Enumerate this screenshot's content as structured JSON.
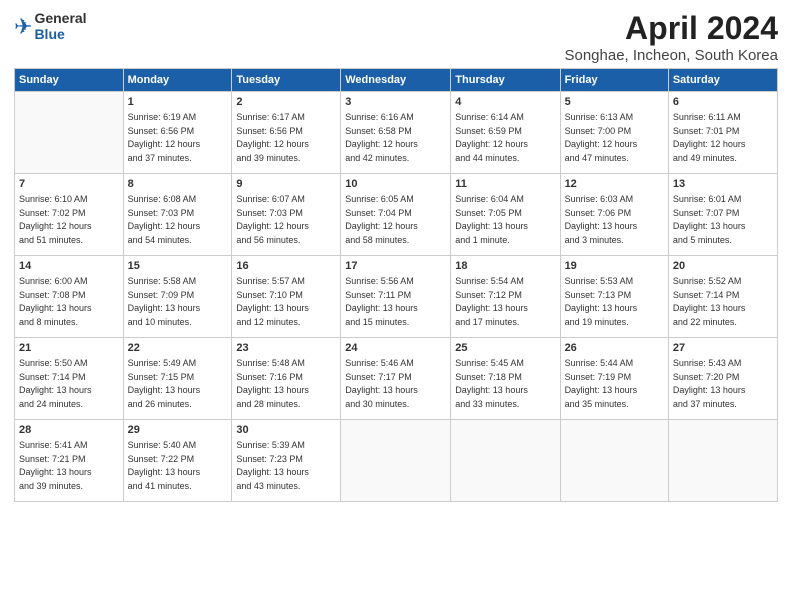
{
  "logo": {
    "general": "General",
    "blue": "Blue"
  },
  "title": "April 2024",
  "subtitle": "Songhae, Incheon, South Korea",
  "days_header": [
    "Sunday",
    "Monday",
    "Tuesday",
    "Wednesday",
    "Thursday",
    "Friday",
    "Saturday"
  ],
  "weeks": [
    [
      {
        "day": "",
        "info": ""
      },
      {
        "day": "1",
        "info": "Sunrise: 6:19 AM\nSunset: 6:56 PM\nDaylight: 12 hours\nand 37 minutes."
      },
      {
        "day": "2",
        "info": "Sunrise: 6:17 AM\nSunset: 6:56 PM\nDaylight: 12 hours\nand 39 minutes."
      },
      {
        "day": "3",
        "info": "Sunrise: 6:16 AM\nSunset: 6:58 PM\nDaylight: 12 hours\nand 42 minutes."
      },
      {
        "day": "4",
        "info": "Sunrise: 6:14 AM\nSunset: 6:59 PM\nDaylight: 12 hours\nand 44 minutes."
      },
      {
        "day": "5",
        "info": "Sunrise: 6:13 AM\nSunset: 7:00 PM\nDaylight: 12 hours\nand 47 minutes."
      },
      {
        "day": "6",
        "info": "Sunrise: 6:11 AM\nSunset: 7:01 PM\nDaylight: 12 hours\nand 49 minutes."
      }
    ],
    [
      {
        "day": "7",
        "info": "Sunrise: 6:10 AM\nSunset: 7:02 PM\nDaylight: 12 hours\nand 51 minutes."
      },
      {
        "day": "8",
        "info": "Sunrise: 6:08 AM\nSunset: 7:03 PM\nDaylight: 12 hours\nand 54 minutes."
      },
      {
        "day": "9",
        "info": "Sunrise: 6:07 AM\nSunset: 7:03 PM\nDaylight: 12 hours\nand 56 minutes."
      },
      {
        "day": "10",
        "info": "Sunrise: 6:05 AM\nSunset: 7:04 PM\nDaylight: 12 hours\nand 58 minutes."
      },
      {
        "day": "11",
        "info": "Sunrise: 6:04 AM\nSunset: 7:05 PM\nDaylight: 13 hours\nand 1 minute."
      },
      {
        "day": "12",
        "info": "Sunrise: 6:03 AM\nSunset: 7:06 PM\nDaylight: 13 hours\nand 3 minutes."
      },
      {
        "day": "13",
        "info": "Sunrise: 6:01 AM\nSunset: 7:07 PM\nDaylight: 13 hours\nand 5 minutes."
      }
    ],
    [
      {
        "day": "14",
        "info": "Sunrise: 6:00 AM\nSunset: 7:08 PM\nDaylight: 13 hours\nand 8 minutes."
      },
      {
        "day": "15",
        "info": "Sunrise: 5:58 AM\nSunset: 7:09 PM\nDaylight: 13 hours\nand 10 minutes."
      },
      {
        "day": "16",
        "info": "Sunrise: 5:57 AM\nSunset: 7:10 PM\nDaylight: 13 hours\nand 12 minutes."
      },
      {
        "day": "17",
        "info": "Sunrise: 5:56 AM\nSunset: 7:11 PM\nDaylight: 13 hours\nand 15 minutes."
      },
      {
        "day": "18",
        "info": "Sunrise: 5:54 AM\nSunset: 7:12 PM\nDaylight: 13 hours\nand 17 minutes."
      },
      {
        "day": "19",
        "info": "Sunrise: 5:53 AM\nSunset: 7:13 PM\nDaylight: 13 hours\nand 19 minutes."
      },
      {
        "day": "20",
        "info": "Sunrise: 5:52 AM\nSunset: 7:14 PM\nDaylight: 13 hours\nand 22 minutes."
      }
    ],
    [
      {
        "day": "21",
        "info": "Sunrise: 5:50 AM\nSunset: 7:14 PM\nDaylight: 13 hours\nand 24 minutes."
      },
      {
        "day": "22",
        "info": "Sunrise: 5:49 AM\nSunset: 7:15 PM\nDaylight: 13 hours\nand 26 minutes."
      },
      {
        "day": "23",
        "info": "Sunrise: 5:48 AM\nSunset: 7:16 PM\nDaylight: 13 hours\nand 28 minutes."
      },
      {
        "day": "24",
        "info": "Sunrise: 5:46 AM\nSunset: 7:17 PM\nDaylight: 13 hours\nand 30 minutes."
      },
      {
        "day": "25",
        "info": "Sunrise: 5:45 AM\nSunset: 7:18 PM\nDaylight: 13 hours\nand 33 minutes."
      },
      {
        "day": "26",
        "info": "Sunrise: 5:44 AM\nSunset: 7:19 PM\nDaylight: 13 hours\nand 35 minutes."
      },
      {
        "day": "27",
        "info": "Sunrise: 5:43 AM\nSunset: 7:20 PM\nDaylight: 13 hours\nand 37 minutes."
      }
    ],
    [
      {
        "day": "28",
        "info": "Sunrise: 5:41 AM\nSunset: 7:21 PM\nDaylight: 13 hours\nand 39 minutes."
      },
      {
        "day": "29",
        "info": "Sunrise: 5:40 AM\nSunset: 7:22 PM\nDaylight: 13 hours\nand 41 minutes."
      },
      {
        "day": "30",
        "info": "Sunrise: 5:39 AM\nSunset: 7:23 PM\nDaylight: 13 hours\nand 43 minutes."
      },
      {
        "day": "",
        "info": ""
      },
      {
        "day": "",
        "info": ""
      },
      {
        "day": "",
        "info": ""
      },
      {
        "day": "",
        "info": ""
      }
    ]
  ]
}
